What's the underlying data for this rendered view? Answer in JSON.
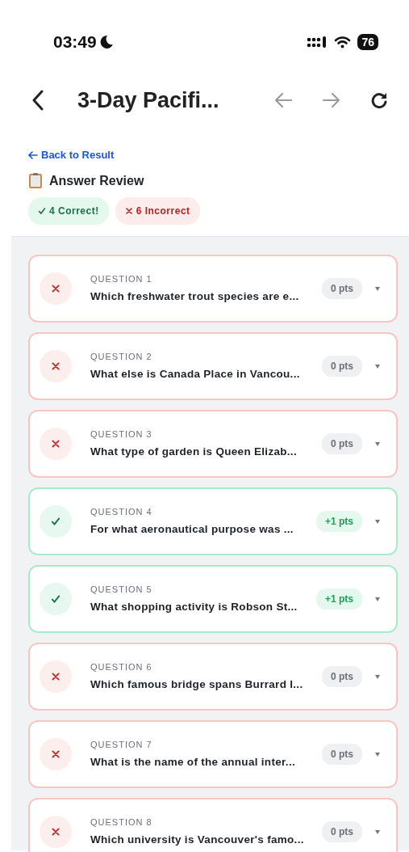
{
  "status_bar": {
    "time": "03:49",
    "battery": "76"
  },
  "nav": {
    "title": "3-Day Pacifi..."
  },
  "back_link": "Back to Result",
  "heading": "Answer Review",
  "summary": [
    {
      "kind": "correct",
      "label": "4 Correct!"
    },
    {
      "kind": "incorrect",
      "label": "6 Incorrect"
    }
  ],
  "questions": [
    {
      "label": "QUESTION 1",
      "text": "Which freshwater trout species are e...",
      "correct": false,
      "points": "0 pts"
    },
    {
      "label": "QUESTION 2",
      "text": "What else is Canada Place in Vancou...",
      "correct": false,
      "points": "0 pts"
    },
    {
      "label": "QUESTION 3",
      "text": "What type of garden is Queen Elizab...",
      "correct": false,
      "points": "0 pts"
    },
    {
      "label": "QUESTION 4",
      "text": "For what aeronautical purpose was ...",
      "correct": true,
      "points": "+1 pts"
    },
    {
      "label": "QUESTION 5",
      "text": "What shopping activity is Robson St...",
      "correct": true,
      "points": "+1 pts"
    },
    {
      "label": "QUESTION 6",
      "text": "Which famous bridge spans Burrard I...",
      "correct": false,
      "points": "0 pts"
    },
    {
      "label": "QUESTION 7",
      "text": "What is the name of the annual inter...",
      "correct": false,
      "points": "0 pts"
    },
    {
      "label": "QUESTION 8",
      "text": "Which university is Vancouver's famo...",
      "correct": false,
      "points": "0 pts"
    }
  ]
}
